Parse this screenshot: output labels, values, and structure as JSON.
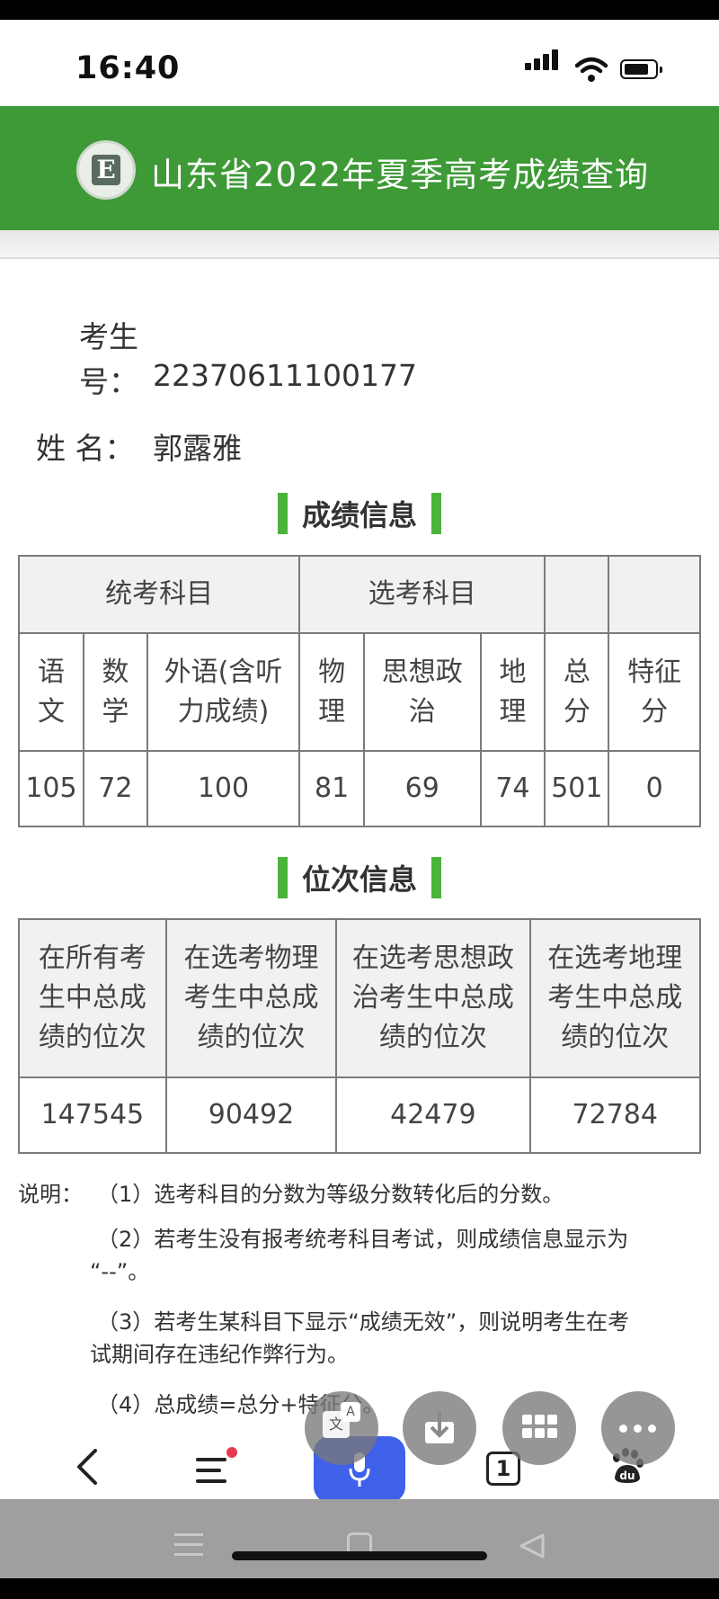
{
  "status": {
    "time": "16:40"
  },
  "header": {
    "title": "山东省2022年夏季高考成绩查询"
  },
  "student": {
    "id_label_line1": "考生",
    "id_label_line2": "号：",
    "id_value": "22370611100177",
    "name_label": "姓 名：",
    "name_value": "郭露雅"
  },
  "scores": {
    "section_title": "成绩信息",
    "group_unified": "统考科目",
    "group_elective": "选考科目",
    "columns": [
      {
        "l1": "语",
        "l2": "文",
        "value": "105"
      },
      {
        "l1": "数",
        "l2": "学",
        "value": "72"
      },
      {
        "l1": "外语(含听",
        "l2": "力成绩)",
        "value": "100"
      },
      {
        "l1": "物",
        "l2": "理",
        "value": "81"
      },
      {
        "l1": "思想政",
        "l2": "治",
        "value": "69"
      },
      {
        "l1": "地",
        "l2": "理",
        "value": "74"
      },
      {
        "l1": "总",
        "l2": "分",
        "value": "501"
      },
      {
        "l1": "特征",
        "l2": "分",
        "value": "0"
      }
    ]
  },
  "ranks": {
    "section_title": "位次信息",
    "columns": [
      {
        "l1": "在所有考",
        "l2": "生中总成",
        "l3": "绩的位次",
        "value": "147545"
      },
      {
        "l1": "在选考物理",
        "l2": "考生中总成",
        "l3": "绩的位次",
        "value": "90492"
      },
      {
        "l1": "在选考思想政",
        "l2": "治考生中总成",
        "l3": "绩的位次",
        "value": "42479"
      },
      {
        "l1": "在选考地理",
        "l2": "考生中总成",
        "l3": "绩的位次",
        "value": "72784"
      }
    ]
  },
  "notes": {
    "label": "说明：",
    "n1": "（1）选考科目的分数为等级分数转化后的分数。",
    "n2a": "（2）若考生没有报考统考科目考试，则成绩信息显示为",
    "n2b": "“--”。",
    "n3a": "（3）若考生某科目下显示“成绩无效”，则说明考生在考",
    "n3b": "试期间存在违纪作弊行为。",
    "n4": "（4）总成绩=总分+特征分。"
  },
  "browser": {
    "tab_count": "1"
  }
}
